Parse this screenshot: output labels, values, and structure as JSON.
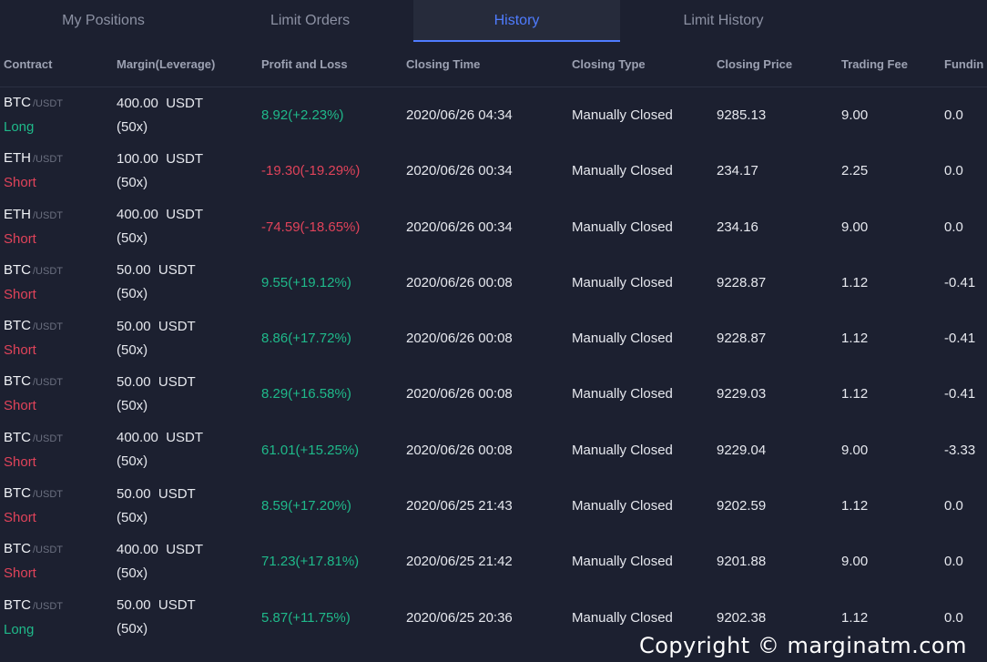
{
  "tabs": [
    {
      "label": "My Positions",
      "active": false
    },
    {
      "label": "Limit Orders",
      "active": false
    },
    {
      "label": "History",
      "active": true
    },
    {
      "label": "Limit History",
      "active": false
    }
  ],
  "columns": {
    "contract": "Contract",
    "margin": "Margin(Leverage)",
    "pnl": "Profit and Loss",
    "closing_time": "Closing Time",
    "closing_type": "Closing Type",
    "closing_price": "Closing Price",
    "trading_fee": "Trading Fee",
    "funding": "Fundin"
  },
  "rows": [
    {
      "symbol": "BTC",
      "quote": "/USDT",
      "side": "Long",
      "margin": "400.00  USDT",
      "leverage": "(50x)",
      "pnl": "8.92(+2.23%)",
      "pnl_sign": "pos",
      "closing_time": "2020/06/26 04:34",
      "closing_type": "Manually Closed",
      "closing_price": "9285.13",
      "trading_fee": "9.00",
      "funding": "0.0"
    },
    {
      "symbol": "ETH",
      "quote": "/USDT",
      "side": "Short",
      "margin": "100.00  USDT",
      "leverage": "(50x)",
      "pnl": "-19.30(-19.29%)",
      "pnl_sign": "neg",
      "closing_time": "2020/06/26 00:34",
      "closing_type": "Manually Closed",
      "closing_price": "234.17",
      "trading_fee": "2.25",
      "funding": "0.0"
    },
    {
      "symbol": "ETH",
      "quote": "/USDT",
      "side": "Short",
      "margin": "400.00  USDT",
      "leverage": "(50x)",
      "pnl": "-74.59(-18.65%)",
      "pnl_sign": "neg",
      "closing_time": "2020/06/26 00:34",
      "closing_type": "Manually Closed",
      "closing_price": "234.16",
      "trading_fee": "9.00",
      "funding": "0.0"
    },
    {
      "symbol": "BTC",
      "quote": "/USDT",
      "side": "Short",
      "margin": "50.00  USDT",
      "leverage": "(50x)",
      "pnl": "9.55(+19.12%)",
      "pnl_sign": "pos",
      "closing_time": "2020/06/26 00:08",
      "closing_type": "Manually Closed",
      "closing_price": "9228.87",
      "trading_fee": "1.12",
      "funding": "-0.41"
    },
    {
      "symbol": "BTC",
      "quote": "/USDT",
      "side": "Short",
      "margin": "50.00  USDT",
      "leverage": "(50x)",
      "pnl": "8.86(+17.72%)",
      "pnl_sign": "pos",
      "closing_time": "2020/06/26 00:08",
      "closing_type": "Manually Closed",
      "closing_price": "9228.87",
      "trading_fee": "1.12",
      "funding": "-0.41"
    },
    {
      "symbol": "BTC",
      "quote": "/USDT",
      "side": "Short",
      "margin": "50.00  USDT",
      "leverage": "(50x)",
      "pnl": "8.29(+16.58%)",
      "pnl_sign": "pos",
      "closing_time": "2020/06/26 00:08",
      "closing_type": "Manually Closed",
      "closing_price": "9229.03",
      "trading_fee": "1.12",
      "funding": "-0.41"
    },
    {
      "symbol": "BTC",
      "quote": "/USDT",
      "side": "Short",
      "margin": "400.00  USDT",
      "leverage": "(50x)",
      "pnl": "61.01(+15.25%)",
      "pnl_sign": "pos",
      "closing_time": "2020/06/26 00:08",
      "closing_type": "Manually Closed",
      "closing_price": "9229.04",
      "trading_fee": "9.00",
      "funding": "-3.33"
    },
    {
      "symbol": "BTC",
      "quote": "/USDT",
      "side": "Short",
      "margin": "50.00  USDT",
      "leverage": "(50x)",
      "pnl": "8.59(+17.20%)",
      "pnl_sign": "pos",
      "closing_time": "2020/06/25 21:43",
      "closing_type": "Manually Closed",
      "closing_price": "9202.59",
      "trading_fee": "1.12",
      "funding": "0.0"
    },
    {
      "symbol": "BTC",
      "quote": "/USDT",
      "side": "Short",
      "margin": "400.00  USDT",
      "leverage": "(50x)",
      "pnl": "71.23(+17.81%)",
      "pnl_sign": "pos",
      "closing_time": "2020/06/25 21:42",
      "closing_type": "Manually Closed",
      "closing_price": "9201.88",
      "trading_fee": "9.00",
      "funding": "0.0"
    },
    {
      "symbol": "BTC",
      "quote": "/USDT",
      "side": "Long",
      "margin": "50.00  USDT",
      "leverage": "(50x)",
      "pnl": "5.87(+11.75%)",
      "pnl_sign": "pos",
      "closing_time": "2020/06/25 20:36",
      "closing_type": "Manually Closed",
      "closing_price": "9202.38",
      "trading_fee": "1.12",
      "funding": "0.0"
    }
  ],
  "colors": {
    "accent": "#4f7cff",
    "positive": "#1fb98a",
    "negative": "#e0435a",
    "background": "#1c2030"
  },
  "watermark": "Copyright © marginatm.com"
}
